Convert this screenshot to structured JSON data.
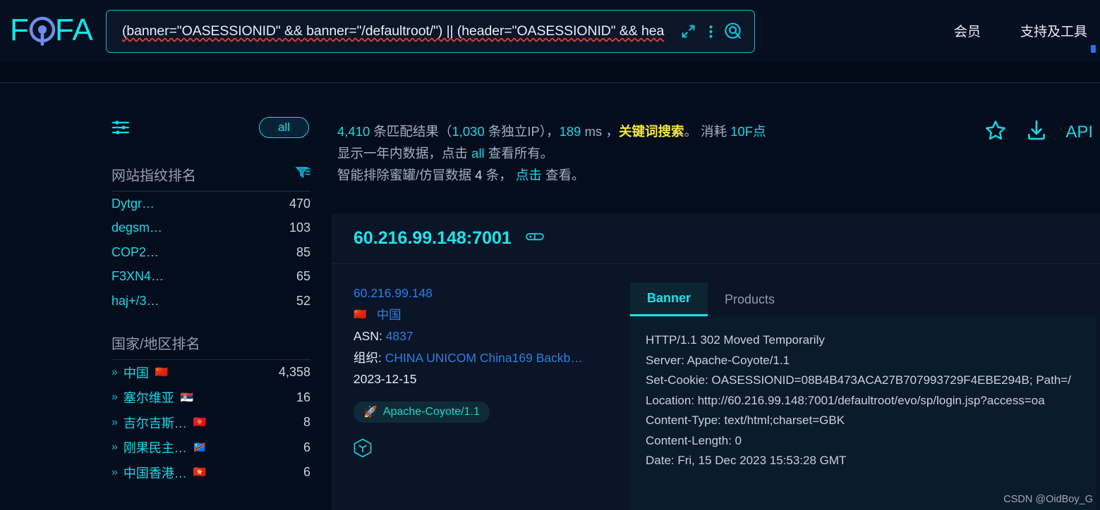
{
  "header": {
    "logo_text": "FOFA",
    "search_query": "(banner=\"OASESSIONID\" && banner=\"/defaultroot/\") || (header=\"OASESSIONID\" && hea",
    "icons": {
      "expand": "expand-icon",
      "more": "more-options-icon",
      "search": "search-icon"
    },
    "nav": [
      {
        "label": "会员"
      },
      {
        "label": "支持及工具"
      }
    ]
  },
  "sidebar": {
    "filter_icon_label": "filter-icon",
    "all_pill": "all",
    "fingerprint": {
      "title": "网站指纹排名",
      "rows": [
        {
          "label": "Dytgr…",
          "count": "470"
        },
        {
          "label": "degsm…",
          "count": "103"
        },
        {
          "label": "COP2…",
          "count": "85"
        },
        {
          "label": "F3XN4…",
          "count": "65"
        },
        {
          "label": "haj+/3…",
          "count": "52"
        }
      ]
    },
    "country": {
      "title": "国家/地区排名",
      "rows": [
        {
          "label": "中国",
          "flag": "🇨🇳",
          "count": "4,358"
        },
        {
          "label": "塞尔维亚",
          "flag": "🇷🇸",
          "count": "16"
        },
        {
          "label": "吉尔吉斯…",
          "flag": "🇰🇬",
          "count": "8"
        },
        {
          "label": "刚果民主…",
          "flag": "🇨🇩",
          "count": "6"
        },
        {
          "label": "中国香港…",
          "flag": "🇭🇰",
          "count": "6"
        }
      ]
    }
  },
  "summary": {
    "line1": {
      "count": "4,410",
      "text_a": " 条匹配结果（",
      "unique": "1,030",
      "text_b": " 条独立IP），",
      "ms": "189",
      "text_c": " ms ，",
      "mode": "关键词搜索",
      "text_d": "。 消耗 ",
      "cost": "10F点"
    },
    "line2": {
      "text_a": "显示一年内数据，点击 ",
      "link": "all",
      "text_b": " 查看所有。"
    },
    "line3": {
      "text_a": "智能排除蜜罐/仿冒数据 ",
      "num": "4",
      "text_b": " 条， ",
      "link": "点击",
      "text_c": " 查看。"
    }
  },
  "actions": {
    "star": "star-icon",
    "download": "download-icon",
    "api_label": "API"
  },
  "result": {
    "ip_port": "60.216.99.148:7001",
    "link_icon": "link-icon",
    "ip": "60.216.99.148",
    "flag": "🇨🇳",
    "country": "中国",
    "asn_key": "ASN:",
    "asn_value": "4837",
    "org_key": "组织:",
    "org_value": "CHINA UNICOM China169 Backb…",
    "date": "2023-12-15",
    "tag": "Apache-Coyote/1.1",
    "tag_icon": "🚀",
    "cube_icon": "cube-icon",
    "tabs": [
      {
        "label": "Banner",
        "active": true
      },
      {
        "label": "Products",
        "active": false
      }
    ],
    "banner_lines": [
      "HTTP/1.1 302 Moved Temporarily",
      "Server: Apache-Coyote/1.1",
      "Set-Cookie: OASESSIONID=08B4B473ACA27B707993729F4EBE294B; Path=/",
      "Location: http://60.216.99.148:7001/defaultroot/evo/sp/login.jsp?access=oa",
      "Content-Type: text/html;charset=GBK",
      "Content-Length: 0",
      "Date: Fri, 15 Dec 2023 15:53:28 GMT"
    ]
  },
  "watermark": "CSDN @OidBoy_G",
  "colors": {
    "page_bg": "#040d1c",
    "accent_cyan": "#1fd6e4",
    "link_blue": "#2f7de0",
    "highlight_yellow": "#f5e53f",
    "card_bg": "#0a1527"
  }
}
